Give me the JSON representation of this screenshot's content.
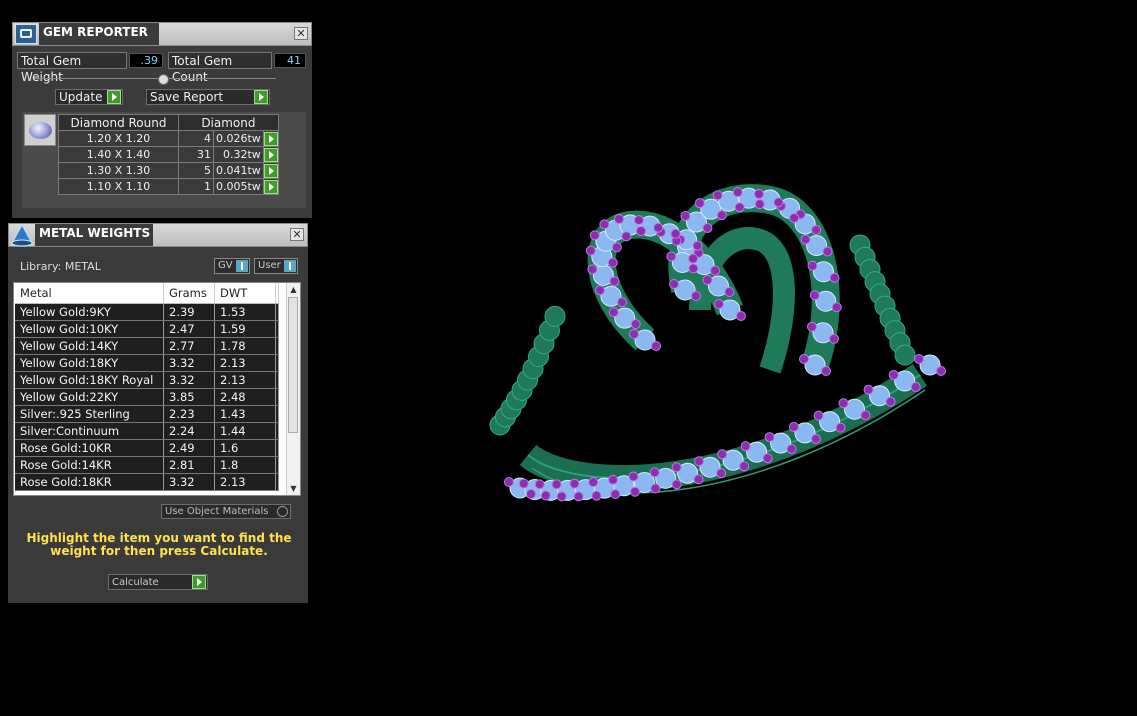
{
  "gem_reporter": {
    "title": "GEM REPORTER",
    "total_weight_label": "Total Gem Weight",
    "total_weight_value": ".39",
    "total_count_label": "Total Gem Count",
    "total_count_value": "41",
    "update_label": "Update",
    "save_report_label": "Save Report",
    "table_header_shape": "Diamond Round",
    "table_header_material": "Diamond",
    "rows": [
      {
        "size": "1.20 X 1.20",
        "count": "4",
        "weight": "0.026tw"
      },
      {
        "size": "1.40 X 1.40",
        "count": "31",
        "weight": "0.32tw"
      },
      {
        "size": "1.30 X 1.30",
        "count": "5",
        "weight": "0.041tw"
      },
      {
        "size": "1.10 X 1.10",
        "count": "1",
        "weight": "0.005tw"
      }
    ]
  },
  "metal_weights": {
    "title": "METAL WEIGHTS",
    "library_label": "Library: METAL",
    "toggle_gv": "GV",
    "toggle_user": "User",
    "columns": [
      "Metal",
      "Grams",
      "DWT"
    ],
    "rows": [
      {
        "metal": "Yellow Gold:9KY",
        "grams": "2.39",
        "dwt": "1.53"
      },
      {
        "metal": "Yellow Gold:10KY",
        "grams": "2.47",
        "dwt": "1.59"
      },
      {
        "metal": "Yellow Gold:14KY",
        "grams": "2.77",
        "dwt": "1.78"
      },
      {
        "metal": "Yellow Gold:18KY",
        "grams": "3.32",
        "dwt": "2.13"
      },
      {
        "metal": "Yellow Gold:18KY Royal",
        "grams": "3.32",
        "dwt": "2.13"
      },
      {
        "metal": "Yellow Gold:22KY",
        "grams": "3.85",
        "dwt": "2.48"
      },
      {
        "metal": "Silver:.925 Sterling",
        "grams": "2.23",
        "dwt": "1.43"
      },
      {
        "metal": "Silver:Continuum",
        "grams": "2.24",
        "dwt": "1.44"
      },
      {
        "metal": "Rose Gold:10KR",
        "grams": "2.49",
        "dwt": "1.6"
      },
      {
        "metal": "Rose Gold:14KR",
        "grams": "2.81",
        "dwt": "1.8"
      },
      {
        "metal": "Rose Gold:18KR",
        "grams": "3.32",
        "dwt": "2.13"
      }
    ],
    "use_object_materials_label": "Use Object Materials",
    "hint_text": "Highlight the item you want to find the weight for then press Calculate.",
    "calculate_label": "Calculate"
  },
  "colors": {
    "metal_green": "#1f7a5a",
    "stone_blue": "#8ab8f0",
    "prong_purple": "#8b2fb0",
    "hint_yellow": "#ffe04d"
  }
}
